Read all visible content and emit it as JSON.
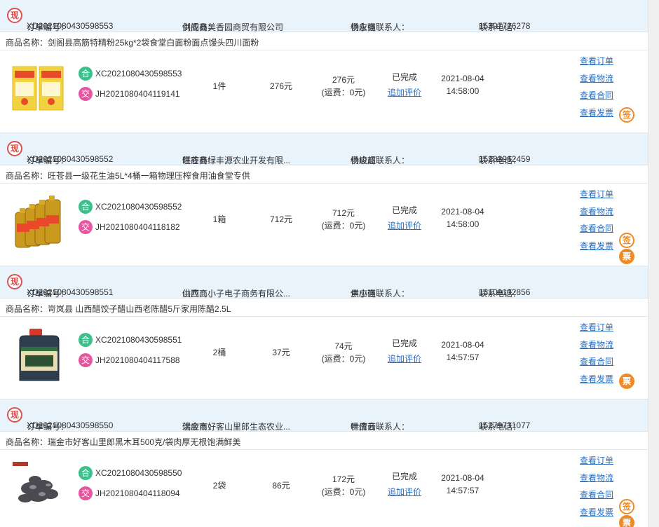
{
  "labels": {
    "order_no": "订单编号：",
    "supplier": "供应商：",
    "contact": "供应商联系人：",
    "phone": "联系电话：",
    "product": "商品名称：",
    "freight_prefix": "(运费：",
    "freight_suffix": ")"
  },
  "badges": {
    "xian": "现",
    "he": "合",
    "jiao": "交",
    "qian": "签",
    "piao": "票"
  },
  "actions": [
    "查看订单",
    "查看物流",
    "查看合同",
    "查看发票"
  ],
  "review_link": "追加评价",
  "colors": {
    "header_bg": "#e9f3fc",
    "link": "#2a6fc1",
    "xian_red": "#d9534f",
    "he_green": "#3cbf8a",
    "jiao_pink": "#e6559f",
    "badge_orange": "#f08a24"
  },
  "orders": [
    {
      "order_no": "XD2021080430598553",
      "supplier": "剑阁县美香园商贸有限公司",
      "contact": "杨永强",
      "phone": "15397726278",
      "product": "剑阁县高筋特精粉25kg*2袋食堂白面粉面点馒头四川面粉",
      "thumb": "flour-bag",
      "contract_no": "XC2021080430598553",
      "deal_no": "JH2021080404119141",
      "qty": "1件",
      "unit_price": "276元",
      "total": "276元",
      "freight": "0元",
      "status": "已完成",
      "date": "2021-08-04",
      "time": "14:58:00",
      "sign": true,
      "invoice": false
    },
    {
      "order_no": "XD2021080430598552",
      "supplier": "旺苍县绿丰源农业开发有限...",
      "contact": "杨峻超",
      "phone": "15283962459",
      "product": "旺苍县一级花生油5L*4桶一箱物理压榨食用油食堂专供",
      "thumb": "oil-bottles",
      "contract_no": "XC2021080430598552",
      "deal_no": "JH2021080404118182",
      "qty": "1箱",
      "unit_price": "712元",
      "total": "712元",
      "freight": "0元",
      "status": "已完成",
      "date": "2021-08-04",
      "time": "14:58:00",
      "sign": true,
      "invoice": true
    },
    {
      "order_no": "XD2021080430598551",
      "supplier": "山西二小子电子商务有限公...",
      "contact": "焦小强",
      "phone": "13100102856",
      "product": "岢岚县 山西醋饺子醋山西老陈醋5斤家用陈醋2.5L",
      "thumb": "vinegar-jug",
      "contract_no": "XC2021080430598551",
      "deal_no": "JH2021080404117588",
      "qty": "2桶",
      "unit_price": "37元",
      "total": "74元",
      "freight": "0元",
      "status": "已完成",
      "date": "2021-08-04",
      "time": "14:57:57",
      "sign": false,
      "invoice": true
    },
    {
      "order_no": "XD2021080430598550",
      "supplier": "瑞金市好客山里郎生态农业...",
      "contact": "叶倩云",
      "phone": "15279731077",
      "product": "瑞金市好客山里郎黑木耳500克/袋肉厚无根饱满鲜美",
      "thumb": "black-fungus",
      "contract_no": "XC2021080430598550",
      "deal_no": "JH2021080404118094",
      "qty": "2袋",
      "unit_price": "86元",
      "total": "172元",
      "freight": "0元",
      "status": "已完成",
      "date": "2021-08-04",
      "time": "14:57:57",
      "sign": true,
      "invoice": true
    }
  ]
}
